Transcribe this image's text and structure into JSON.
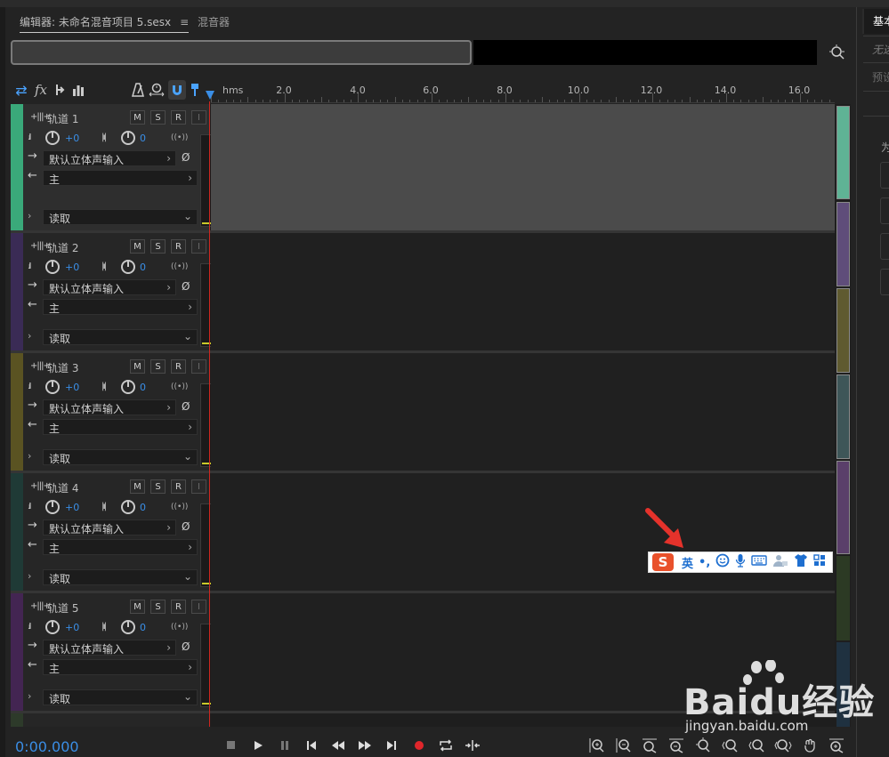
{
  "tabs": {
    "editor_label": "编辑器: 未命名混音项目 5.sesx",
    "editor_menu": "≡",
    "mixer_label": "混音器"
  },
  "right_panel": {
    "tab_label": "基本",
    "text_1": "无选",
    "text_2": "预设",
    "text_3": "为"
  },
  "toolbar": {
    "sync_icon": "sync-arrows-icon",
    "fx_label": "fx",
    "send_icon": "send-icon",
    "eq_icon": "eq-icon",
    "metronome_icon": "metronome-icon",
    "stretch_icon": "time-stretch-icon",
    "snap_icon": "snap-magnet-icon",
    "pin_icon": "pin-icon"
  },
  "ruler": {
    "unit": "hms",
    "ticks": [
      "2.0",
      "4.0",
      "6.0",
      "8.0",
      "10.0",
      "12.0",
      "14.0",
      "16.0"
    ]
  },
  "tracks": [
    {
      "name": "轨道 1",
      "color": "#3aa97a",
      "volume": "+0",
      "pan": "0",
      "input": "默认立体声输入",
      "output": "主",
      "automation": "读取",
      "selected": true
    },
    {
      "name": "轨道 2",
      "color": "#3a2b55",
      "volume": "+0",
      "pan": "0",
      "input": "默认立体声输入",
      "output": "主",
      "automation": "读取",
      "selected": false
    },
    {
      "name": "轨道 3",
      "color": "#5a5322",
      "volume": "+0",
      "pan": "0",
      "input": "默认立体声输入",
      "output": "主",
      "automation": "读取",
      "selected": false
    },
    {
      "name": "轨道 4",
      "color": "#1f3a36",
      "volume": "+0",
      "pan": "0",
      "input": "默认立体声输入",
      "output": "主",
      "automation": "读取",
      "selected": false
    },
    {
      "name": "轨道 5",
      "color": "#432552",
      "volume": "+0",
      "pan": "0",
      "input": "默认立体声输入",
      "output": "主",
      "automation": "读取",
      "selected": false
    }
  ],
  "track_buttons": {
    "m": "M",
    "s": "S",
    "r": "R",
    "i": "I"
  },
  "transport": {
    "timecode": "0:00.000",
    "buttons": [
      "stop-icon",
      "play-icon",
      "pause-icon",
      "to-start-icon",
      "rewind-icon",
      "fast-forward-icon",
      "to-end-icon",
      "record-icon",
      "loop-icon",
      "skip-selection-icon"
    ]
  },
  "zoom_buttons": [
    "zoom-in-amplitude-icon",
    "zoom-out-amplitude-icon",
    "zoom-in-time-icon",
    "zoom-out-time-icon",
    "zoom-selection-icon",
    "zoom-in-left-icon",
    "zoom-in-right-icon",
    "zoom-full-icon",
    "zoom-tracks-icon",
    "zoom-reset-icon"
  ],
  "ime": {
    "logo": "S",
    "lang": "英",
    "punct": "•,",
    "items": [
      "☺",
      "🎤",
      "⌨",
      "👕",
      "▦"
    ]
  },
  "watermark": {
    "text": "Baidu经验",
    "sub": "jingyan.baidu.com"
  },
  "scroll_colors": [
    "#5fb395",
    "#5f4d7a",
    "#5f5a30",
    "#3e5658",
    "#5a3f6a",
    "#2c3a24",
    "#1f3140"
  ]
}
